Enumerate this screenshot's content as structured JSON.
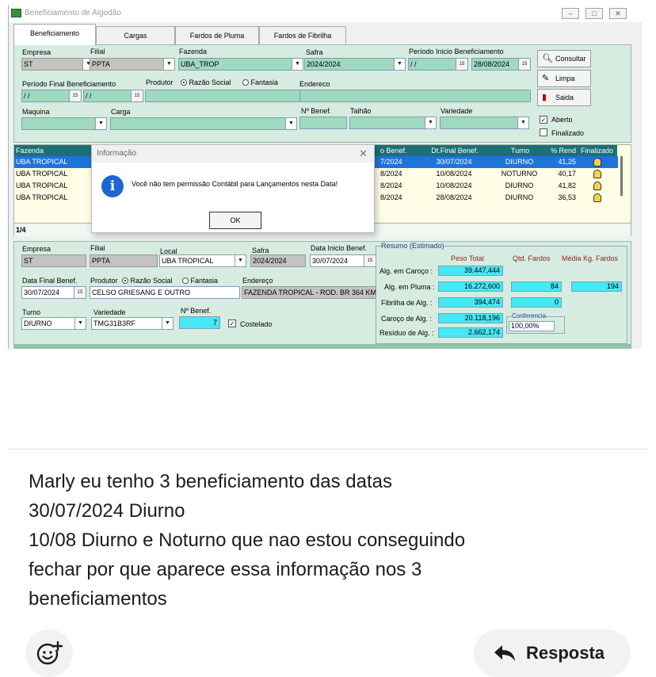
{
  "window": {
    "title": "Beneficiamento de Algodão",
    "controls": [
      "minimize-icon",
      "maximize-icon",
      "close-icon"
    ]
  },
  "tabs": [
    {
      "label": "Beneficiamento",
      "active": true
    },
    {
      "label": "Cargas"
    },
    {
      "label": "Fardos de Pluma"
    },
    {
      "label": "Fardos de Fibrilha"
    }
  ],
  "filters": {
    "empresa_label": "Empresa",
    "empresa_value": "ST",
    "filial_label": "Filial",
    "filial_value": "PPTA",
    "fazenda_label": "Fazenda",
    "fazenda_value": "UBA_TROP",
    "safra_label": "Safra",
    "safra_value": "2024/2024",
    "periodo_inicio_label": "Período Inicio Beneficiamento",
    "periodo_inicio_de": " / /",
    "periodo_inicio_ate": "28/08/2024",
    "periodo_final_label": "Período Final Beneficiamento",
    "periodo_final_de": " / /",
    "periodo_final_ate": " / /",
    "produtor_label": "Produtor",
    "razao_social": "Razão Social",
    "fantasia": "Fantasia",
    "endereco_label": "Endereco",
    "maquina_label": "Maquina",
    "carga_label": "Carga",
    "nbenef_label": "Nº Benef.",
    "talhao_label": "Talhão",
    "variedade_label": "Variedade",
    "aberto_label": "Aberto",
    "aberto_checked": true,
    "finalizado_label": "Finalizado",
    "finalizado_checked": false
  },
  "side_buttons": {
    "consultar": "Consultar",
    "limpa": "Limpa",
    "saida": "Saida"
  },
  "grid": {
    "headers": {
      "fazenda": "Fazenda",
      "benef": "o Benef.",
      "dtfinal": "Dt.Final Benef.",
      "turno": "Turno",
      "rend": "% Rend",
      "finalizado": "Finalizado"
    },
    "rows": [
      {
        "fazenda": "UBA TROPICAL",
        "benef": "7/2024",
        "dtfinal": "30/07/2024",
        "turno": "DIURNO",
        "rend": "41,25",
        "selected": true
      },
      {
        "fazenda": "UBA TROPICAL",
        "benef": "8/2024",
        "dtfinal": "10/08/2024",
        "turno": "NOTURNO",
        "rend": "40,17"
      },
      {
        "fazenda": "UBA TROPICAL",
        "benef": "8/2024",
        "dtfinal": "10/08/2024",
        "turno": "DIURNO",
        "rend": "41,82"
      },
      {
        "fazenda": "UBA TROPICAL",
        "benef": "8/2024",
        "dtfinal": "28/08/2024",
        "turno": "DIURNO",
        "rend": "36,53"
      }
    ],
    "counter": "1/4"
  },
  "dialog": {
    "title": "Informação",
    "message": "Você não tem permissão Contábil para Lançamentos nesta Data!",
    "ok": "OK"
  },
  "detail": {
    "empresa_label": "Empresa",
    "empresa_value": "ST",
    "filial_label": "Filial",
    "filial_value": "PPTA",
    "local_label": "Local",
    "local_value": "UBA TROPICAL",
    "safra_label": "Safra",
    "safra_value": "2024/2024",
    "data_inicio_label": "Data Inicio Benef.",
    "data_inicio_value": "30/07/2024",
    "data_final_label": "Data Final Benef.",
    "data_final_value": "30/07/2024",
    "produtor_label": "Produtor",
    "razao_social": "Razão Social",
    "fantasia": "Fantasia",
    "produtor_value": "CELSO GRIESANG E OUTRO",
    "endereco_label": "Endereço",
    "endereco_value": "FAZENDA TROPICAL - ROD. BR 364 KM",
    "turno_label": "Turno",
    "turno_value": "DIURNO",
    "variedade_label": "Variedade",
    "variedade_value": "TMG31B3RF",
    "nbenef_label": "Nº Benef.",
    "nbenef_value": "7",
    "costelado_label": "Costelado",
    "costelado_checked": true
  },
  "resumo": {
    "title": "Resumo (Estimado)",
    "col_peso": "Peso Total",
    "col_qtd": "Qtd. Fardos",
    "col_media": "Média Kg. Fardos",
    "rows": [
      {
        "label": "Alg. em Caroço :",
        "peso": "39.447,444",
        "qtd": "",
        "media": ""
      },
      {
        "label": "Alg. em Pluma :",
        "peso": "16.272,600",
        "qtd": "84",
        "media": "194"
      },
      {
        "label": "Fibrilha de Alg. :",
        "peso": "394,474",
        "qtd": "0",
        "media": ""
      },
      {
        "label": "Caroço de Alg. :",
        "peso": "20.118,196",
        "qtd": "",
        "media": ""
      },
      {
        "label": "Resíduo de Alg. :",
        "peso": "2.662,174",
        "qtd": "",
        "media": ""
      }
    ],
    "conferencia_label": "Conferencia",
    "conferencia_value": "100,00%"
  },
  "message": {
    "lines": [
      "Marly eu tenho 3 beneficiamento das datas",
      "30/07/2024 Diurno",
      "10/08 Diurno e Noturno que nao estou conseguindo",
      "fechar por que aparece essa informação nos 3",
      "beneficiamentos"
    ]
  },
  "actions": {
    "react_icon": "add-reaction-icon",
    "reply_label": "Resposta",
    "reply_icon": "reply-arrow-icon"
  }
}
